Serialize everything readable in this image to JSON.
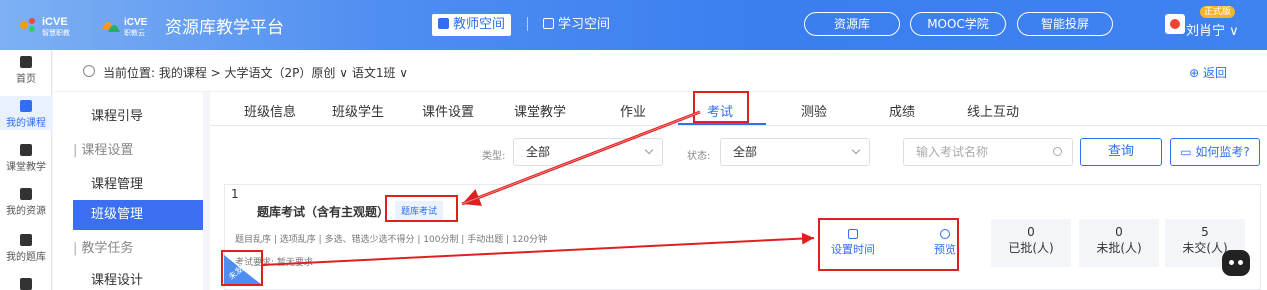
{
  "header": {
    "logo1_text": "iCVE 智慧职教",
    "logo2_text": "iCVE 职教云",
    "platform_title": "资源库教学平台",
    "space_teacher": "教师空间",
    "space_student": "学习空间",
    "btn_resource": "资源库",
    "btn_mooc": "MOOC学院",
    "btn_screen": "智能投屏",
    "badge": "正式版",
    "username": "刘肖宁 ∨"
  },
  "rail": [
    {
      "label": "首页",
      "icon": "home-icon"
    },
    {
      "label": "我的课程",
      "icon": "book-icon"
    },
    {
      "label": "课堂教学",
      "icon": "play-icon"
    },
    {
      "label": "我的资源",
      "icon": "folder-icon"
    },
    {
      "label": "我的题库",
      "icon": "question-bank-icon"
    },
    {
      "label": "",
      "icon": "more-icon"
    }
  ],
  "breadcrumb": {
    "text": "当前位置: 我的课程 > 大学语文（2P）原创 ∨  语文1班 ∨",
    "back": "返回"
  },
  "subnav": [
    {
      "label": "课程引导",
      "type": "item"
    },
    {
      "label": "课程设置",
      "type": "group"
    },
    {
      "label": "课程管理",
      "type": "item"
    },
    {
      "label": "班级管理",
      "type": "active"
    },
    {
      "label": "教学任务",
      "type": "group"
    },
    {
      "label": "课程设计",
      "type": "item"
    }
  ],
  "tabs": [
    "班级信息",
    "班级学生",
    "课件设置",
    "课堂教学",
    "作业",
    "考试",
    "测验",
    "成绩",
    "线上互动"
  ],
  "filters": {
    "type_label": "类型:",
    "type_value": "全部",
    "status_label": "状态:",
    "status_value": "全部",
    "search_placeholder": "输入考试名称",
    "query": "查询",
    "how_monitor": "如何监考?"
  },
  "exam": {
    "index": "1",
    "title": "题库考试（含有主观题）",
    "type_tag": "题库考试",
    "meta": "题目乱序 | 选项乱序 | 多选、错选少选不得分 | 100分制 | 手动出题 | 120分钟",
    "requirement": "考试要求: 暂无要求",
    "corner": "未发布",
    "action_time": "设置时间",
    "action_preview": "预览",
    "stats": [
      {
        "n": "0",
        "l": "已批(人)"
      },
      {
        "n": "0",
        "l": "未批(人)"
      },
      {
        "n": "5",
        "l": "未交(人)"
      }
    ]
  },
  "colors": {
    "accent": "#2f6ff0",
    "highlight": "#e02020"
  }
}
